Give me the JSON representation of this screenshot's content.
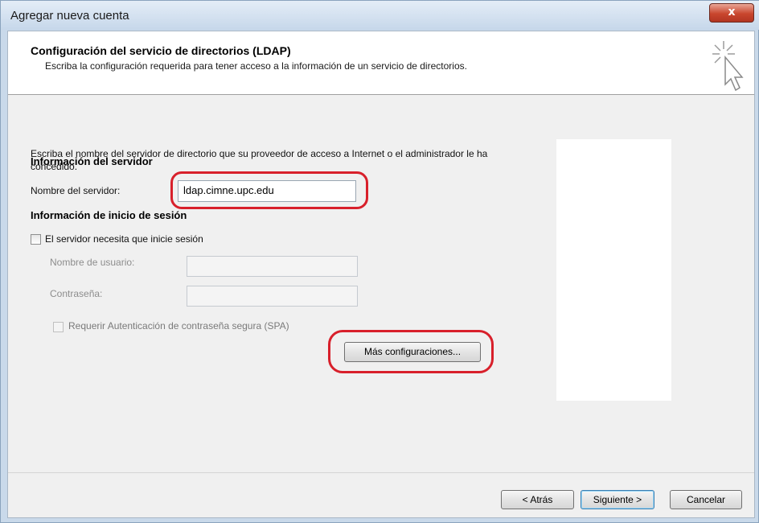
{
  "window": {
    "title": "Agregar nueva cuenta",
    "close_label": "x"
  },
  "header": {
    "title": "Configuración del servicio de directorios (LDAP)",
    "subtitle": "Escriba la configuración requerida para tener acceso a la información de un servicio de directorios."
  },
  "server_info": {
    "section_title": "Información del servidor",
    "description": "Escriba el nombre del servidor de directorio que su proveedor de acceso a Internet o el administrador le ha concedido.",
    "server_label": "Nombre del servidor:",
    "server_value": "ldap.cimne.upc.edu"
  },
  "logon_info": {
    "section_title": "Información de inicio de sesión",
    "requires_logon_label": "El servidor necesita que inicie sesión",
    "requires_logon_checked": false,
    "username_label": "Nombre de usuario:",
    "username_value": "",
    "password_label": "Contraseña:",
    "password_value": "",
    "spa_label": "Requerir Autenticación de contraseña segura (SPA)",
    "spa_checked": false,
    "more_settings_label": "Más configuraciones..."
  },
  "footer": {
    "back_label": "< Atrás",
    "next_label": "Siguiente >",
    "cancel_label": "Cancelar"
  },
  "colors": {
    "highlight": "#d8202b",
    "close_button": "#c9462e"
  },
  "icons": {
    "wizard": "wizard-cursor-sparkle-icon"
  }
}
